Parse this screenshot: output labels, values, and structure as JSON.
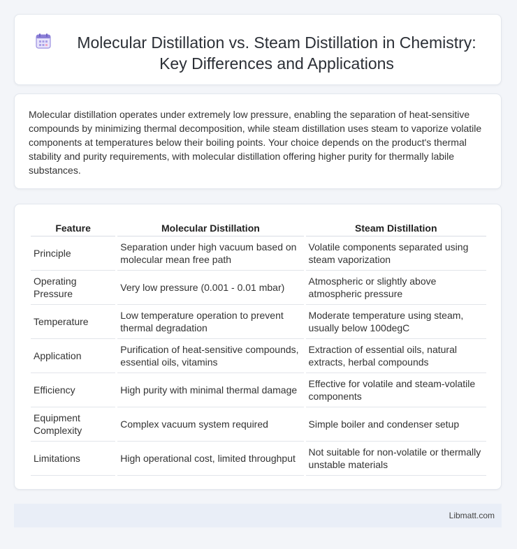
{
  "header": {
    "title": "Molecular Distillation vs. Steam Distillation in Chemistry: Key Differences and Applications",
    "icon": "calendar-icon"
  },
  "intro": {
    "text": "Molecular distillation operates under extremely low pressure, enabling the separation of heat-sensitive compounds by minimizing thermal decomposition, while steam distillation uses steam to vaporize volatile components at temperatures below their boiling points. Your choice depends on the product's thermal stability and purity requirements, with molecular distillation offering higher purity for thermally labile substances."
  },
  "table": {
    "headers": [
      "Feature",
      "Molecular Distillation",
      "Steam Distillation"
    ],
    "rows": [
      [
        "Principle",
        "Separation under high vacuum based on molecular mean free path",
        "Volatile components separated using steam vaporization"
      ],
      [
        "Operating Pressure",
        "Very low pressure (0.001 - 0.01 mbar)",
        "Atmospheric or slightly above atmospheric pressure"
      ],
      [
        "Temperature",
        "Low temperature operation to prevent thermal degradation",
        "Moderate temperature using steam, usually below 100degC"
      ],
      [
        "Application",
        "Purification of heat-sensitive compounds, essential oils, vitamins",
        "Extraction of essential oils, natural extracts, herbal compounds"
      ],
      [
        "Efficiency",
        "High purity with minimal thermal damage",
        "Effective for volatile and steam-volatile components"
      ],
      [
        "Equipment Complexity",
        "Complex vacuum system required",
        "Simple boiler and condenser setup"
      ],
      [
        "Limitations",
        "High operational cost, limited throughput",
        "Not suitable for non-volatile or thermally unstable materials"
      ]
    ]
  },
  "footer": {
    "brand": "Libmatt.com"
  },
  "colors": {
    "background": "#f3f5f9",
    "card": "#ffffff",
    "footer": "#e9eef7",
    "icon_accent": "#8b7fd6"
  }
}
